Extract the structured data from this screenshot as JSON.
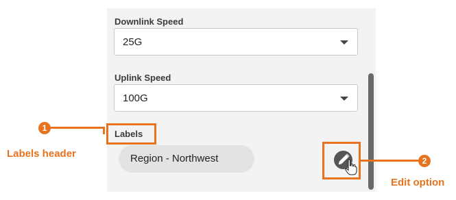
{
  "form": {
    "downlink": {
      "label": "Downlink Speed",
      "value": "25G"
    },
    "uplink": {
      "label": "Uplink Speed",
      "value": "100G"
    },
    "labels": {
      "header": "Labels",
      "chip": "Region - Northwest"
    }
  },
  "annotations": {
    "callout_1": {
      "number": "1",
      "text": "Labels header"
    },
    "callout_2": {
      "number": "2",
      "text": "Edit option"
    }
  },
  "colors": {
    "accent": "#e8731e",
    "panel": "#f3f3f3"
  },
  "icons": {
    "edit": "pencil-icon",
    "cursor": "hand-cursor-icon",
    "dropdown": "chevron-down-icon"
  }
}
